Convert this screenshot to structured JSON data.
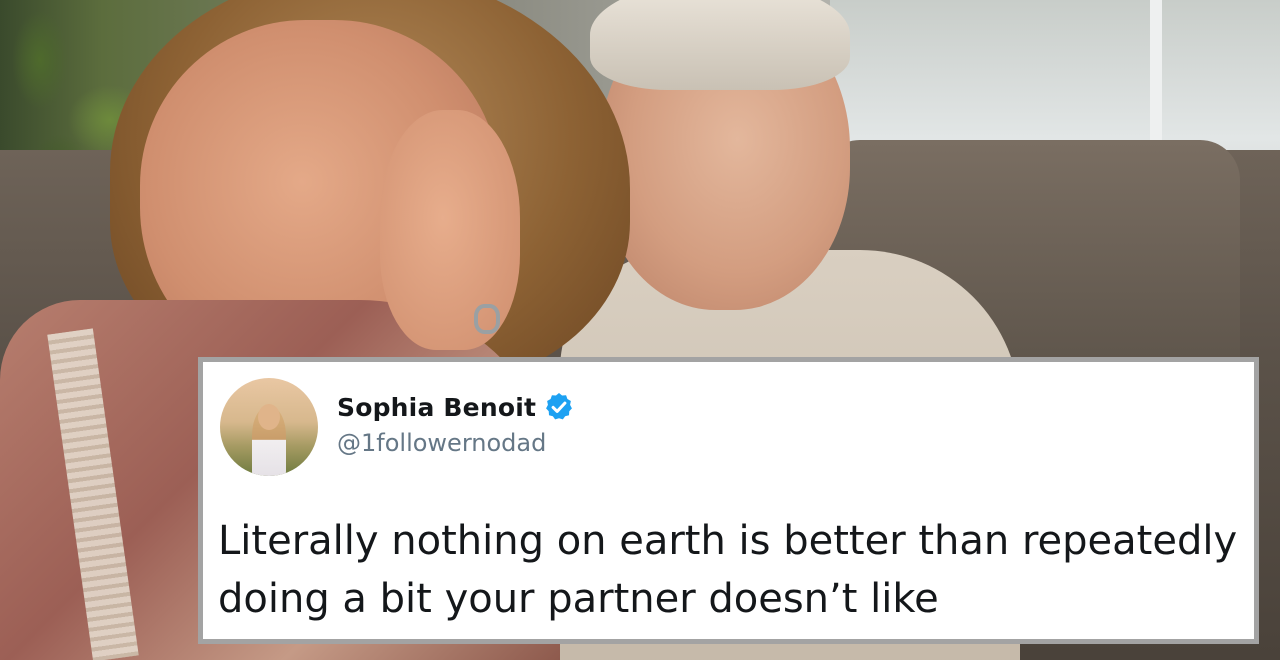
{
  "tweet": {
    "display_name": "Sophia Benoit",
    "handle": "@1followernodad",
    "text": "Literally nothing on earth is better than repeatedly doing a bit your partner doesn’t like",
    "verified": true
  },
  "colors": {
    "card_border": "#a3a3a3",
    "verified_badge": "#1da1f2",
    "name_text": "#14171a",
    "handle_text": "#657786"
  },
  "icons": {
    "verified": "verified-badge-icon",
    "avatar": "profile-avatar"
  }
}
